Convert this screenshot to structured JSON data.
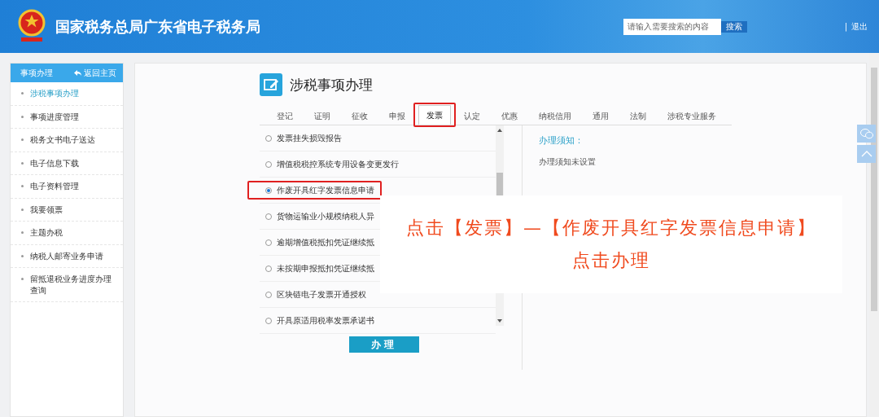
{
  "header": {
    "title": "国家税务总局广东省电子税务局",
    "search": {
      "placeholder": "请输入需要搜索的内容",
      "button": "搜索"
    },
    "separator": "|",
    "logout": "退出"
  },
  "sidebar": {
    "title": "事项办理",
    "back": "返回主页",
    "items": [
      {
        "label": "涉税事项办理",
        "selected": true
      },
      {
        "label": "事项进度管理",
        "selected": false
      },
      {
        "label": "税务文书电子送达",
        "selected": false
      },
      {
        "label": "电子信息下载",
        "selected": false
      },
      {
        "label": "电子资料管理",
        "selected": false
      },
      {
        "label": "我要领票",
        "selected": false
      },
      {
        "label": "主题办税",
        "selected": false
      },
      {
        "label": "纳税人邮寄业务申请",
        "selected": false
      },
      {
        "label": "留抵退税业务进度办理查询",
        "selected": false
      }
    ]
  },
  "page": {
    "title": "涉税事项办理",
    "tabs": [
      {
        "label": "登记",
        "selected": false
      },
      {
        "label": "证明",
        "selected": false
      },
      {
        "label": "征收",
        "selected": false
      },
      {
        "label": "申报",
        "selected": false
      },
      {
        "label": "发票",
        "selected": true,
        "highlighted": true
      },
      {
        "label": "认定",
        "selected": false
      },
      {
        "label": "优惠",
        "selected": false
      },
      {
        "label": "纳税信用",
        "selected": false
      },
      {
        "label": "通用",
        "selected": false
      },
      {
        "label": "法制",
        "selected": false
      },
      {
        "label": "涉税专业服务",
        "selected": false
      }
    ],
    "items": [
      {
        "label": "发票挂失损毁报告",
        "selected": false
      },
      {
        "label": "增值税税控系统专用设备变更发行",
        "selected": false
      },
      {
        "label": "作废开具红字发票信息申请",
        "selected": true,
        "highlighted": true
      },
      {
        "label": "货物运输业小规模纳税人异",
        "selected": false
      },
      {
        "label": "逾期增值税抵扣凭证继续抵",
        "selected": false
      },
      {
        "label": "未按期申报抵扣凭证继续抵",
        "selected": false
      },
      {
        "label": "区块链电子发票开通授权",
        "selected": false
      },
      {
        "label": "开具原适用税率发票承诺书",
        "selected": false
      }
    ],
    "action": "办理",
    "notice": {
      "title": "办理须知：",
      "text": "办理须知未设置"
    }
  },
  "overlay": {
    "lines": [
      "点击【发票】—【作废开具红字发票信息申请】",
      "点击办理"
    ]
  }
}
